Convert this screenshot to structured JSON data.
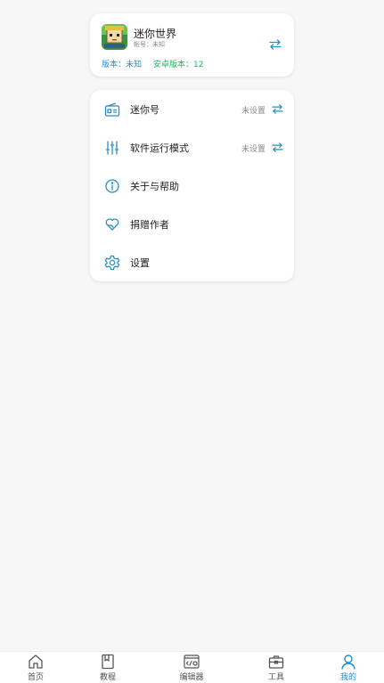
{
  "game": {
    "name": "迷你世界",
    "account": "帐号：未知",
    "version_label": "版本：未知",
    "android_version_label": "安卓版本：12"
  },
  "menu": [
    {
      "label": "迷你号",
      "status": "未设置",
      "icon": "radio-icon"
    },
    {
      "label": "软件运行模式",
      "status": "未设置",
      "icon": "sliders-icon"
    },
    {
      "label": "关于与帮助",
      "status": "",
      "icon": "info-icon"
    },
    {
      "label": "捐赠作者",
      "status": "",
      "icon": "heart-hand-icon"
    },
    {
      "label": "设置",
      "status": "",
      "icon": "gear-icon"
    }
  ],
  "tabs": [
    {
      "label": "首页",
      "icon": "home-icon",
      "active": false
    },
    {
      "label": "教程",
      "icon": "book-icon",
      "active": false
    },
    {
      "label": "编辑器",
      "icon": "editor-icon",
      "active": false
    },
    {
      "label": "工具",
      "icon": "toolbox-icon",
      "active": false
    },
    {
      "label": "我的",
      "icon": "user-icon",
      "active": true
    }
  ],
  "colors": {
    "accent": "#1e8fd6",
    "green": "#15b85a",
    "icon": "#2a8ec4"
  }
}
